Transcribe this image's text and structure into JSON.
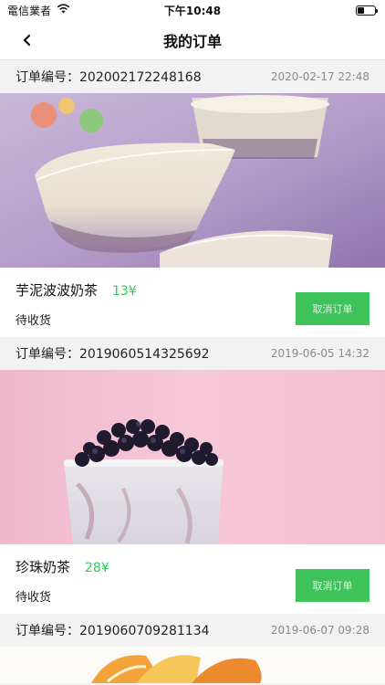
{
  "status_bar": {
    "carrier": "電信業者",
    "time": "下午10:48"
  },
  "nav": {
    "title": "我的订单"
  },
  "orders": [
    {
      "order_no": "订单编号：202002172248168",
      "time": "2020-02-17 22:48",
      "product": "芋泥波波奶茶",
      "price": "13¥",
      "status": "待收货",
      "action": "取消订单"
    },
    {
      "order_no": "订单编号：2019060514325692",
      "time": "2019-06-05 14:32",
      "product": "珍珠奶茶",
      "price": "28¥",
      "status": "待收货",
      "action": "取消订单"
    },
    {
      "order_no": "订单编号：2019060709281134",
      "time": "2019-06-07 09:28"
    }
  ],
  "colors": {
    "accent": "#3ec35a",
    "price": "#2ecc57",
    "background": "#f2f2f2"
  }
}
